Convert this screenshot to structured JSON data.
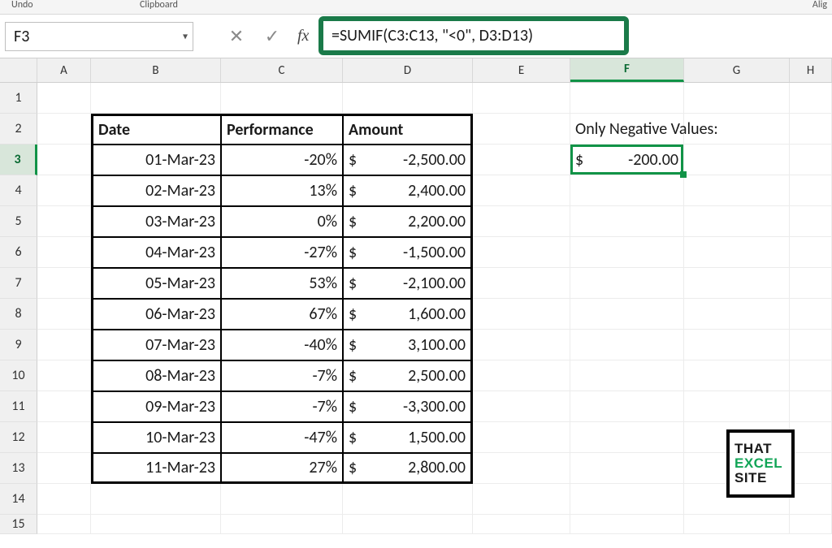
{
  "ribbon": {
    "undo": "Undo",
    "clipboard": "Clipboard",
    "alignment": "Alig"
  },
  "name_box": {
    "value": "F3"
  },
  "fx": {
    "label": "fx"
  },
  "formula_bar": {
    "value": "=SUMIF(C3:C13, \"<0\", D3:D13)"
  },
  "columns": [
    "",
    "A",
    "B",
    "C",
    "D",
    "E",
    "F",
    "G",
    "H"
  ],
  "row_labels": [
    "1",
    "2",
    "3",
    "4",
    "5",
    "6",
    "7",
    "8",
    "9",
    "10",
    "11",
    "12",
    "13",
    "14",
    "15"
  ],
  "table": {
    "headers": {
      "date": "Date",
      "performance": "Performance",
      "amount": "Amount"
    },
    "rows": [
      {
        "date": "01-Mar-23",
        "performance": "-20%",
        "amount": "$ -2,500.00"
      },
      {
        "date": "02-Mar-23",
        "performance": "13%",
        "amount": "$  2,400.00"
      },
      {
        "date": "03-Mar-23",
        "performance": "0%",
        "amount": "$  2,200.00"
      },
      {
        "date": "04-Mar-23",
        "performance": "-27%",
        "amount": "$ -1,500.00"
      },
      {
        "date": "05-Mar-23",
        "performance": "53%",
        "amount": "$ -2,100.00"
      },
      {
        "date": "06-Mar-23",
        "performance": "67%",
        "amount": "$  1,600.00"
      },
      {
        "date": "07-Mar-23",
        "performance": "-40%",
        "amount": "$  3,100.00"
      },
      {
        "date": "08-Mar-23",
        "performance": "-7%",
        "amount": "$  2,500.00"
      },
      {
        "date": "09-Mar-23",
        "performance": "-7%",
        "amount": "$ -3,300.00"
      },
      {
        "date": "10-Mar-23",
        "performance": "-47%",
        "amount": "$  1,500.00"
      },
      {
        "date": "11-Mar-23",
        "performance": "27%",
        "amount": "$  2,800.00"
      }
    ]
  },
  "result": {
    "label": "Only Negative Values:",
    "currency": "$",
    "value": "-200.00"
  },
  "watermark": {
    "l1": "THAT",
    "l2": "EXCEL",
    "l3": "SITE"
  }
}
